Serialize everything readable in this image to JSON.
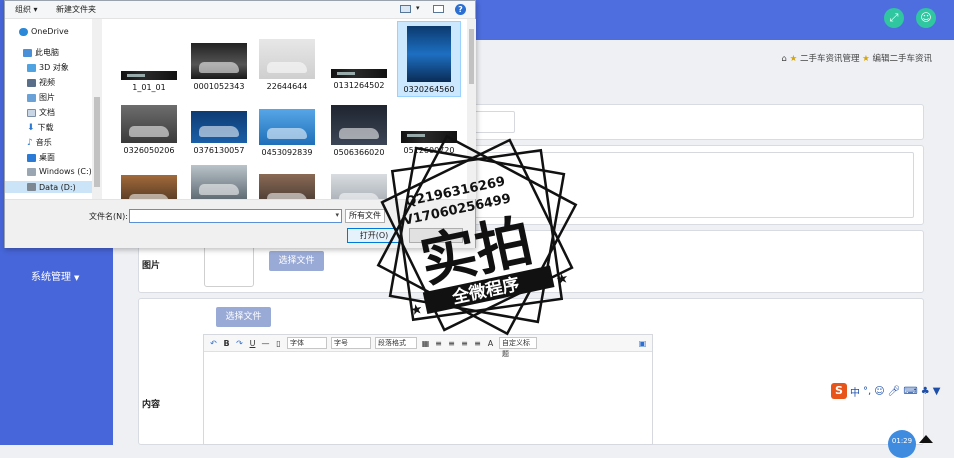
{
  "sidebar": {
    "menu_system": "系统管理"
  },
  "topbar": {
    "icon_left": "fullscreen-icon",
    "icon_right": "user-icon",
    "accent": "#2fc6a0"
  },
  "breadcrumb": {
    "item1": "二手车资讯管理",
    "item2": "编辑二手车资讯"
  },
  "form": {
    "image_label": "图片",
    "content_label": "内容",
    "choose_file": "选择文件",
    "choose_file_2": "选择文件"
  },
  "editor": {
    "font_family": "字体",
    "font_size": "字号",
    "paragraph": "段落格式",
    "custom_title": "自定义标题"
  },
  "ime": {
    "label": "中"
  },
  "clock": {
    "time": "01:29"
  },
  "dialog": {
    "organize": "组织 ▾",
    "new_folder": "新建文件夹",
    "nav": [
      {
        "label": "OneDrive",
        "icon": "cloud-icon"
      },
      {
        "label": "此电脑",
        "icon": "computer-icon"
      },
      {
        "label": "3D 对象",
        "icon": "cube-icon"
      },
      {
        "label": "视频",
        "icon": "video-icon"
      },
      {
        "label": "图片",
        "icon": "picture-icon"
      },
      {
        "label": "文档",
        "icon": "document-icon"
      },
      {
        "label": "下载",
        "icon": "download-icon"
      },
      {
        "label": "音乐",
        "icon": "music-icon"
      },
      {
        "label": "桌面",
        "icon": "desktop-icon"
      },
      {
        "label": "Windows (C:)",
        "icon": "drive-icon"
      },
      {
        "label": "Data (D:)",
        "icon": "drive-icon"
      }
    ],
    "files": [
      {
        "name": "1_01_01"
      },
      {
        "name": "0001052343"
      },
      {
        "name": "22644644"
      },
      {
        "name": "0131264502"
      },
      {
        "name": "0320264560"
      },
      {
        "name": "0326050206"
      },
      {
        "name": "0376130057"
      },
      {
        "name": "0453092839"
      },
      {
        "name": "0506366020"
      },
      {
        "name": "0512600720"
      }
    ],
    "filename_label": "文件名(N):",
    "filename_value": "",
    "file_type": "所有文件",
    "open_button": "打开(O)"
  },
  "watermark": {
    "phone1": "Q2196316269",
    "phone2": "V17060256499",
    "big_text": "实拍",
    "banner": "全微程序"
  }
}
